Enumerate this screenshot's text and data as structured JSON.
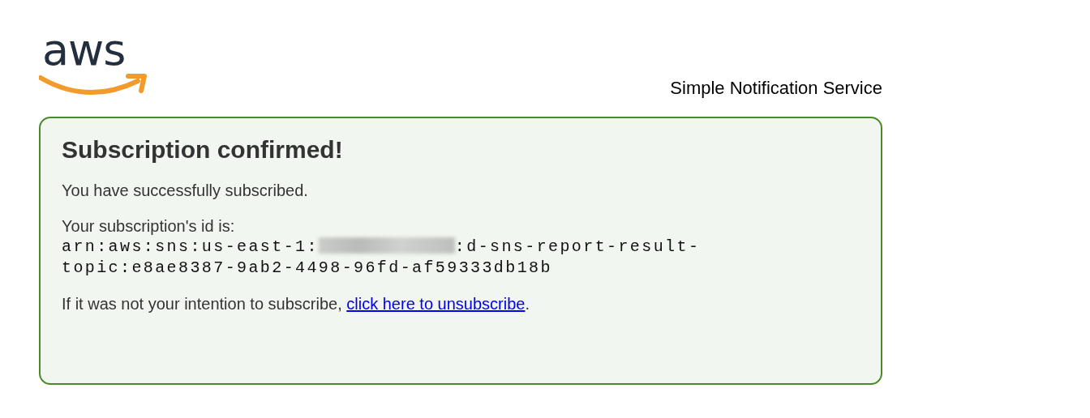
{
  "logo": {
    "text": "aws"
  },
  "header": {
    "service_name": "Simple Notification Service"
  },
  "card": {
    "title": "Subscription confirmed!",
    "message": "You have successfully subscribed.",
    "id_label": "Your subscription's id is:",
    "arn_prefix": "arn:aws:sns:us-east-1:",
    "arn_suffix": ":d-sns-report-result-topic:e8ae8387-9ab2-4498-96fd-af59333db18b",
    "unsubscribe_text": "If it was not your intention to subscribe, ",
    "unsubscribe_link": "click here to unsubscribe",
    "unsubscribe_end": "."
  }
}
